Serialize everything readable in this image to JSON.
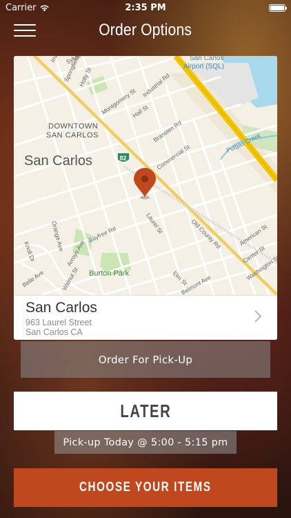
{
  "status_bar": {
    "carrier": "Carrier",
    "time": "2:35 PM"
  },
  "header": {
    "title": "Order Options"
  },
  "map": {
    "labels": {
      "airport": "San Carlos\nAirport (SQL)",
      "downtown": "DOWNTOWN\nSAN CARLOS",
      "city": "San Carlos",
      "highway": "82",
      "park": "Burton Park",
      "creek": "Pulgas Creek",
      "streets": [
        "Holly St",
        "Industrial Rd",
        "Springfield",
        "Sylvan",
        "Inverness",
        "Montgomery St",
        "Hall St",
        "Bransten Rd",
        "Commercial St",
        "Laurel St",
        "Old County Rd",
        "Orange Ave",
        "Bayfree Rd",
        "Arroyo Ave",
        "Knoll Dr",
        "Belle Ave",
        "Elm St",
        "Belmont Ave",
        "American St",
        "Center St",
        "Washington St",
        "Walnut St"
      ]
    }
  },
  "location": {
    "name": "San Carlos",
    "address_line1": "963 Laurel Street",
    "address_line2": "San Carlos CA"
  },
  "buttons": {
    "order_type": "Order For Pick-Up",
    "timing": "LATER",
    "pickup_time": "Pick-up Today @ 5:00 - 5:15 pm",
    "choose_items": "CHOOSE YOUR ITEMS"
  },
  "colors": {
    "accent": "#c0481e",
    "pin": "#c0481e"
  }
}
